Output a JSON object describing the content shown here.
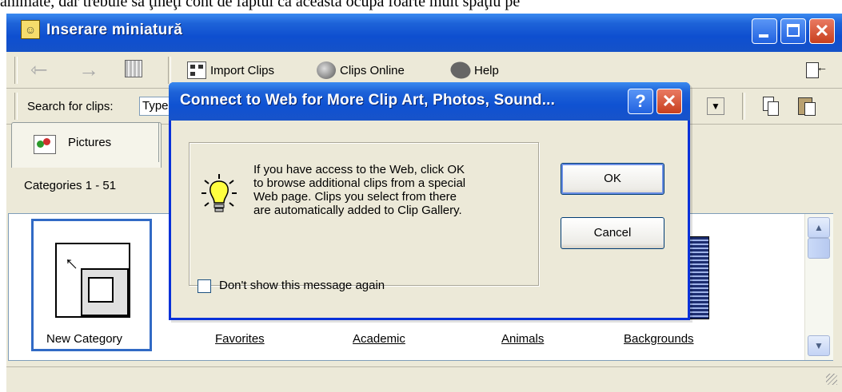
{
  "background_document": {
    "text": "animate, dar trebuie să ţineţi cont de faptul că aceasta ocupă foarte mult spaţiu pe"
  },
  "window": {
    "title": "Inserare miniatură",
    "controls": {
      "minimize": "minimize",
      "maximize": "maximize",
      "close": "✕"
    }
  },
  "toolbar": {
    "back_icon": "back-arrow-icon",
    "forward_icon": "forward-arrow-icon",
    "import_clips": "Import Clips",
    "clips_online": "Clips Online",
    "help": "Help"
  },
  "search": {
    "label": "Search for clips:",
    "value": "Type"
  },
  "tabs": [
    {
      "label": "Pictures",
      "icon": "pictures-icon"
    }
  ],
  "categories": {
    "label": "Categories 1 - 51",
    "items": [
      {
        "label": "New Category"
      },
      {
        "label": "Favorites"
      },
      {
        "label": "Academic"
      },
      {
        "label": "Animals"
      },
      {
        "label": "Backgrounds"
      }
    ]
  },
  "dialog": {
    "title": "Connect to Web for More Clip Art, Photos, Sound...",
    "help_label": "?",
    "close_label": "✕",
    "message_lines": [
      "If you have access to the Web, click OK",
      "to browse additional clips from a special",
      "Web page.  Clips you select from there",
      "are automatically added to Clip Gallery."
    ],
    "ok_label": "OK",
    "cancel_label": "Cancel",
    "checkbox_label": "Don't show this message again",
    "checkbox_checked": false
  },
  "scrollbar": {
    "up": "▲",
    "down": "▼"
  }
}
